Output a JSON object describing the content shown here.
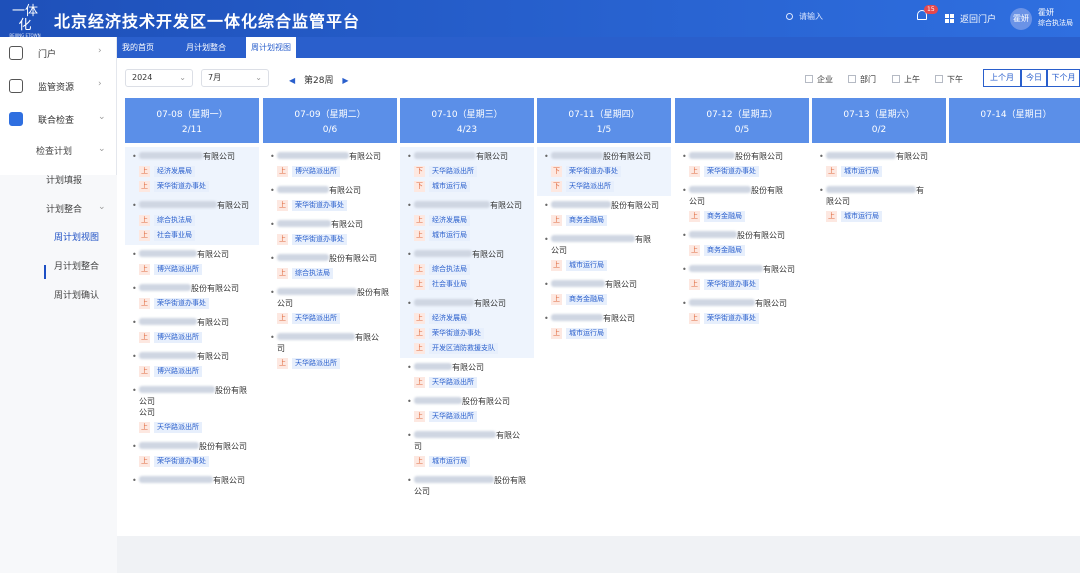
{
  "header": {
    "logo_text": "一体化",
    "logo_sub": "BEIJING ETOWN",
    "title": "北京经济技术开发区一体化综合监管平台",
    "search_placeholder": "请输入",
    "notification_count": "15",
    "back_portal": "返回门户",
    "avatar_text": "霍妍",
    "user_name": "霍妍",
    "user_role": "综合执法局"
  },
  "sidebar": {
    "items": [
      {
        "label": "门户",
        "icon": "portal-icon"
      },
      {
        "label": "监管资源",
        "icon": "resource-icon"
      },
      {
        "label": "联合检查",
        "icon": "inspection-icon"
      }
    ],
    "sub": {
      "check_plan": "检查计划",
      "fill": "计划填报",
      "integrate": "计划整合",
      "week_view": "周计划视图",
      "month_integrate": "月计划整合",
      "week_confirm": "周计划确认"
    }
  },
  "tabs": [
    "我的首页",
    "月计划整合",
    "周计划视图"
  ],
  "toolbar": {
    "year": "2024",
    "month": "7月",
    "week": "第28周",
    "filters": [
      "企业",
      "部门",
      "上午",
      "下午"
    ],
    "nav": [
      "上个月",
      "今日",
      "下个月"
    ]
  },
  "columns": [
    {
      "date": "07-08（星期一）",
      "count": "2/11",
      "cards": [
        {
          "suffix": "有限公司",
          "blur": 64,
          "hl": true,
          "tags": [
            [
              "上",
              "经济发展局"
            ],
            [
              "上",
              "荣华街道办事处"
            ]
          ]
        },
        {
          "suffix": "有限公司",
          "blur": 78,
          "hl": true,
          "tags": [
            [
              "上",
              "综合执法局"
            ],
            [
              "上",
              "社会事业局"
            ]
          ]
        },
        {
          "suffix": "有限公司",
          "blur": 58,
          "tags": [
            [
              "上",
              "博兴路派出所"
            ]
          ]
        },
        {
          "suffix": "股份有限公司",
          "blur": 52,
          "tags": [
            [
              "上",
              "荣华街道办事处"
            ]
          ]
        },
        {
          "suffix": "有限公司",
          "blur": 58,
          "tags": [
            [
              "上",
              "博兴路派出所"
            ]
          ]
        },
        {
          "suffix": "有限公司",
          "blur": 58,
          "tags": [
            [
              "上",
              "博兴路派出所"
            ]
          ]
        },
        {
          "suffix": "股份有限公司",
          "suffix2": "公司",
          "blur": 76,
          "tags": [
            [
              "上",
              "天华路派出所"
            ]
          ]
        },
        {
          "suffix": "股份有限公司",
          "blur": 60,
          "tags": [
            [
              "上",
              "荣华街道办事处"
            ]
          ]
        },
        {
          "suffix": "有限公司",
          "blur": 74,
          "tags": []
        }
      ]
    },
    {
      "date": "07-09（星期二）",
      "count": "0/6",
      "cards": [
        {
          "suffix": "有限公司",
          "blur": 72,
          "tags": [
            [
              "上",
              "博兴路派出所"
            ]
          ]
        },
        {
          "suffix": "有限公司",
          "blur": 52,
          "tags": [
            [
              "上",
              "荣华街道办事处"
            ]
          ]
        },
        {
          "suffix": "有限公司",
          "blur": 54,
          "tags": [
            [
              "上",
              "荣华街道办事处"
            ]
          ]
        },
        {
          "suffix": "股份有限公司",
          "blur": 52,
          "tags": [
            [
              "上",
              "综合执法局"
            ]
          ]
        },
        {
          "suffix": "股份有限",
          "suffix2": "公司",
          "blur": 80,
          "tags": [
            [
              "上",
              "天华路派出所"
            ]
          ]
        },
        {
          "suffix": "有限公",
          "suffix2": "司",
          "blur": 78,
          "tags": [
            [
              "上",
              "天华路派出所"
            ]
          ]
        }
      ]
    },
    {
      "date": "07-10（星期三）",
      "count": "4/23",
      "cards": [
        {
          "suffix": "有限公司",
          "blur": 62,
          "hl": true,
          "tags": [
            [
              "下",
              "天华路派出所"
            ],
            [
              "下",
              "城市运行局"
            ]
          ]
        },
        {
          "suffix": "有限公司",
          "blur": 76,
          "hl": true,
          "tags": [
            [
              "上",
              "经济发展局"
            ],
            [
              "上",
              "城市运行局"
            ]
          ]
        },
        {
          "suffix": "有限公司",
          "blur": 58,
          "hl": true,
          "tags": [
            [
              "上",
              "综合执法局"
            ],
            [
              "上",
              "社会事业局"
            ]
          ]
        },
        {
          "suffix": "有限公司",
          "blur": 60,
          "hl": true,
          "tags": [
            [
              "上",
              "经济发展局"
            ],
            [
              "上",
              "荣华街道办事处"
            ],
            [
              "上",
              "开发区消防救援支队"
            ]
          ]
        },
        {
          "suffix": "有限公司",
          "blur": 38,
          "tags": [
            [
              "上",
              "天华路派出所"
            ]
          ]
        },
        {
          "suffix": "股份有限公司",
          "blur": 48,
          "tags": [
            [
              "上",
              "天华路派出所"
            ]
          ]
        },
        {
          "suffix": "有限公",
          "suffix2": "司",
          "blur": 82,
          "tags": [
            [
              "上",
              "城市运行局"
            ]
          ]
        },
        {
          "suffix": "股份有限",
          "suffix2": "公司",
          "blur": 80,
          "tags": []
        }
      ]
    },
    {
      "date": "07-11（星期四）",
      "count": "1/5",
      "cards": [
        {
          "suffix": "股份有限公司",
          "blur": 52,
          "hl": true,
          "tags": [
            [
              "下",
              "荣华街道办事处"
            ],
            [
              "下",
              "天华路派出所"
            ]
          ]
        },
        {
          "suffix": "股份有限公司",
          "blur": 60,
          "tags": [
            [
              "上",
              "商务金融局"
            ]
          ]
        },
        {
          "suffix": "有限",
          "suffix2": "公司",
          "blur": 84,
          "tags": [
            [
              "上",
              "城市运行局"
            ]
          ]
        },
        {
          "suffix": "有限公司",
          "blur": 54,
          "tags": [
            [
              "上",
              "商务金融局"
            ]
          ]
        },
        {
          "suffix": "有限公司",
          "blur": 52,
          "tags": [
            [
              "上",
              "城市运行局"
            ]
          ]
        }
      ]
    },
    {
      "date": "07-12（星期五）",
      "count": "0/5",
      "cards": [
        {
          "suffix": "股份有限公司",
          "blur": 46,
          "tags": [
            [
              "上",
              "荣华街道办事处"
            ]
          ]
        },
        {
          "suffix": "股份有限",
          "suffix2": "公司",
          "blur": 62,
          "tags": [
            [
              "上",
              "商务金融局"
            ]
          ]
        },
        {
          "suffix": "股份有限公司",
          "blur": 48,
          "tags": [
            [
              "上",
              "商务金融局"
            ]
          ]
        },
        {
          "suffix": "有限公司",
          "blur": 74,
          "tags": [
            [
              "上",
              "荣华街道办事处"
            ]
          ]
        },
        {
          "suffix": "有限公司",
          "blur": 66,
          "tags": [
            [
              "上",
              "荣华街道办事处"
            ]
          ]
        }
      ]
    },
    {
      "date": "07-13（星期六）",
      "count": "0/2",
      "cards": [
        {
          "suffix": "有限公司",
          "blur": 70,
          "tags": [
            [
              "上",
              "城市运行局"
            ]
          ]
        },
        {
          "suffix": "有",
          "suffix2": "限公司",
          "blur": 90,
          "tags": [
            [
              "上",
              "城市运行局"
            ]
          ]
        }
      ]
    },
    {
      "date": "07-14（星期日）",
      "count": "",
      "cards": []
    }
  ]
}
